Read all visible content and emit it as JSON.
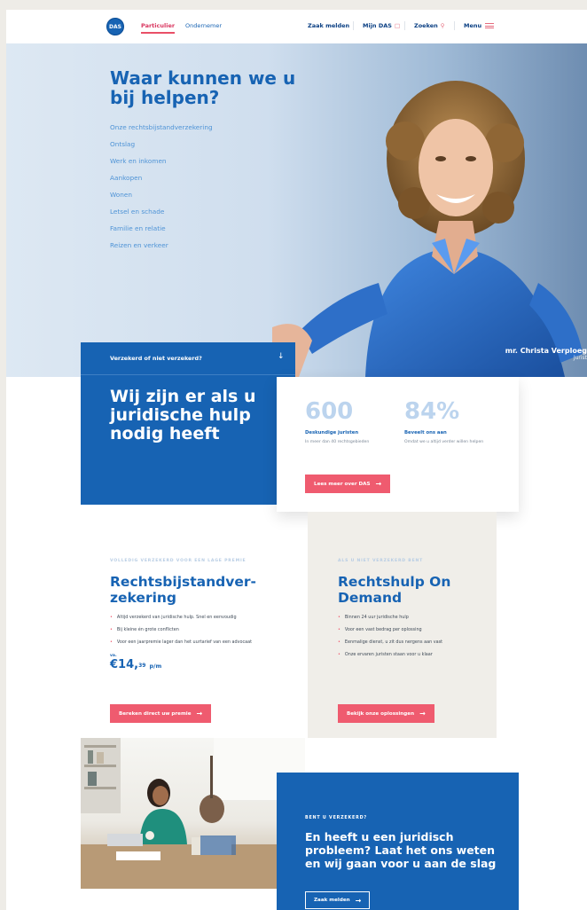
{
  "header": {
    "logo_text": "DAS",
    "tabs": [
      "Particulier",
      "Ondernemer"
    ],
    "zaak_melden": "Zaak melden",
    "mijn_das": "Mijn DAS",
    "zoeken": "Zoeken",
    "menu": "Menu"
  },
  "hero": {
    "title": "Waar kunnen we u bij helpen?",
    "links": [
      "Onze rechtsbijstandverzekering",
      "Ontslag",
      "Werk en inkomen",
      "Aankopen",
      "Wonen",
      "Letsel en schade",
      "Familie en relatie",
      "Reizen en verkeer"
    ],
    "caption_name": "mr. Christa Verploeg",
    "caption_role": "Jurist"
  },
  "intro": {
    "question": "Verzekerd of niet verzekerd?",
    "title": "Wij zijn er als u juridische hulp nodig heeft"
  },
  "stats": {
    "items": [
      {
        "number": "600",
        "label": "Deskundige juristen",
        "desc": "In meer dan 40 rechtsgebieden"
      },
      {
        "number": "84%",
        "label": "Beveelt ons aan",
        "desc": "Omdat we u altijd verder willen helpen"
      }
    ],
    "button": "Lees meer over DAS"
  },
  "products": {
    "rechtsbijstand": {
      "kicker": "VOLLEDIG VERZEKERD VOOR EEN LAGE PREMIE",
      "title": "Rechtsbijstandver-zekering",
      "bullets": [
        "Altijd verzekerd van juridische hulp. Snel en eenvoudig",
        "Bij kleine én grote conflicten",
        "Voor een jaarpremie lager dan het uurtarief van een advocaat"
      ],
      "price_prefix": "vа.",
      "price_main": "€14,",
      "price_cents": "39",
      "price_unit": "p/m",
      "button": "Bereken direct uw premie"
    },
    "ondemand": {
      "kicker": "ALS U NIET VERZEKERD BENT",
      "title": "Rechtshulp On Demand",
      "bullets": [
        "Binnen 24 uur juridische hulp",
        "Voor een vast bedrag per oplossing",
        "Eenmalige dienst, u zit dus nergens aan vast",
        "Onze ervaren juristen staan voor u klaar"
      ],
      "button": "Bekijk onze oplossingen"
    }
  },
  "cta": {
    "kicker": "BENT U VERZEKERD?",
    "title": "En heeft u een juridisch probleem? Laat het ons weten en wij gaan voor u aan de slag",
    "button": "Zaak melden"
  },
  "colors": {
    "brand_blue": "#1763b3",
    "accent_coral": "#ef5b6f",
    "light_blue": "#bcd4ee",
    "beige": "#f0eee9"
  }
}
